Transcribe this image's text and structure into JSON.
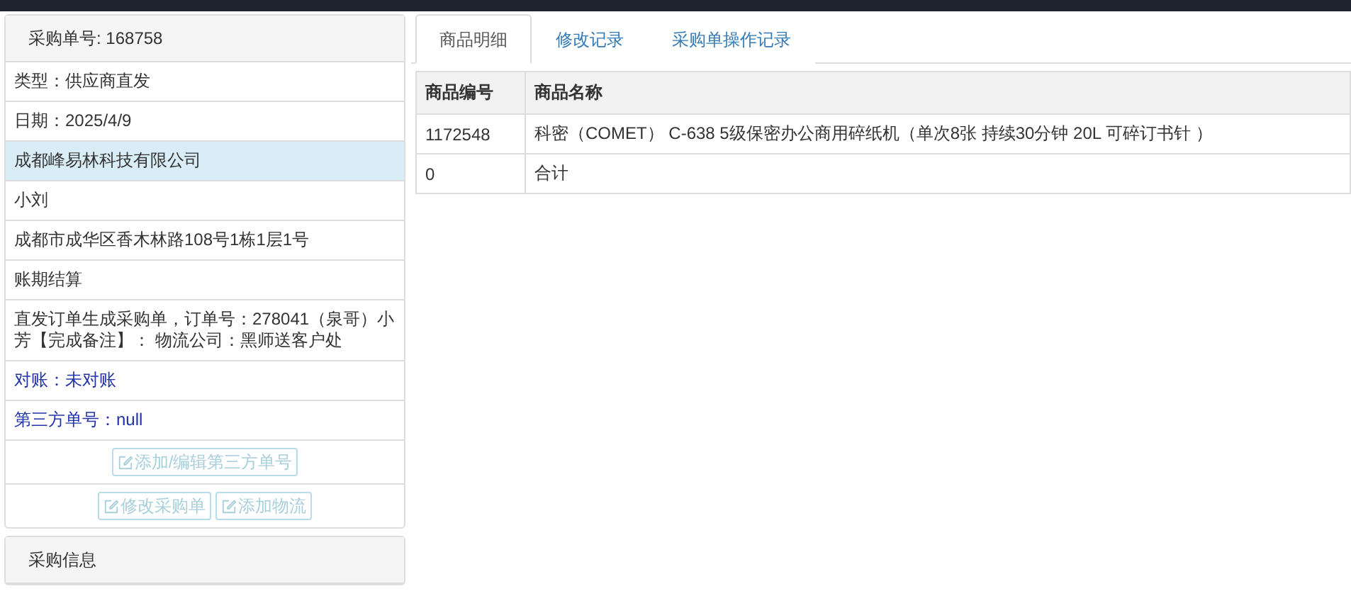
{
  "order_panel": {
    "title": "采购单号: 168758",
    "items": [
      {
        "text": "类型：供应商直发",
        "kind": "plain"
      },
      {
        "text": "日期：2025/4/9",
        "kind": "plain"
      },
      {
        "text": "成都峰易林科技有限公司",
        "kind": "active"
      },
      {
        "text": "小刘",
        "kind": "plain"
      },
      {
        "text": "成都市成华区香木林路108号1栋1层1号",
        "kind": "plain"
      },
      {
        "text": "账期结算",
        "kind": "plain"
      },
      {
        "text": "直发订单生成采购单，订单号：278041（泉哥）小芳【完成备注】： 物流公司：黑师送客户处",
        "kind": "plain"
      },
      {
        "text": "对账：未对账",
        "kind": "info"
      },
      {
        "text": "第三方单号：null",
        "kind": "info"
      }
    ],
    "button_rows": [
      [
        {
          "label": "添加/编辑第三方单号",
          "disabled": true
        }
      ],
      [
        {
          "label": "修改采购单",
          "disabled": true
        },
        {
          "label": "添加物流",
          "disabled": true
        }
      ]
    ]
  },
  "purchase_panel": {
    "title": "采购信息"
  },
  "tabs": [
    {
      "label": "商品明细",
      "selected": true
    },
    {
      "label": "修改记录",
      "selected": false
    },
    {
      "label": "采购单操作记录",
      "selected": false
    }
  ],
  "table": {
    "columns": [
      "商品编号",
      "商品名称"
    ],
    "rows": [
      [
        "1172548",
        "科密（COMET） C-638 5级保密办公商用碎纸机（单次8张 持续30分钟 20L 可碎订书针 ）"
      ],
      [
        "0",
        "合计"
      ]
    ]
  }
}
